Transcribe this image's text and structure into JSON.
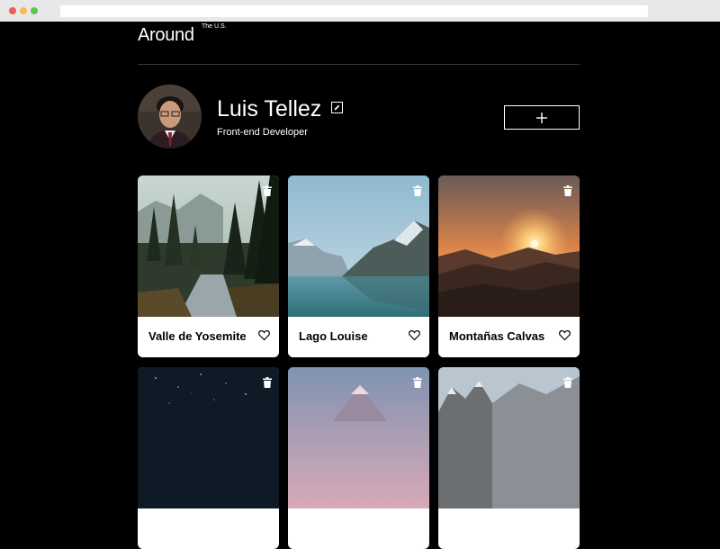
{
  "header": {
    "logo": "Around",
    "logo_superscript": "The U.S."
  },
  "profile": {
    "name": "Luis Tellez",
    "job": "Front-end Developer",
    "edit_icon": "pencil-icon",
    "add_icon": "plus-icon"
  },
  "cards": [
    {
      "title": "Valle de Yosemite",
      "scene": "forest-river"
    },
    {
      "title": "Lago Louise",
      "scene": "mountain-lake"
    },
    {
      "title": "Montañas Calvas",
      "scene": "mountain-sunset"
    },
    {
      "title": "",
      "scene": "night-sky"
    },
    {
      "title": "",
      "scene": "pink-mountains"
    },
    {
      "title": "",
      "scene": "rocky-peaks"
    }
  ],
  "icons": {
    "delete": "trash-icon",
    "like": "heart-icon"
  },
  "colors": {
    "background": "#000000",
    "text": "#ffffff",
    "card": "#ffffff"
  }
}
